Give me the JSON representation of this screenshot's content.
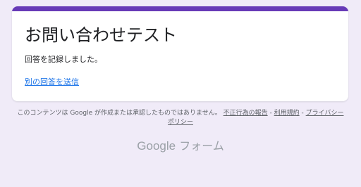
{
  "card": {
    "accent_color": "#673ab7",
    "title": "お問い合わせテスト",
    "message": "回答を記録しました。",
    "another_response_link": "別の回答を送信"
  },
  "footer": {
    "disclaimer_text": "このコンテンツは Google が作成または承認したものではありません。",
    "report_abuse_link": "不正行為の報告",
    "separator": " - ",
    "terms_link": "利用規約",
    "privacy_link": "プライバシー ポリシー",
    "brand_google": "Google",
    "brand_product": "フォーム"
  }
}
